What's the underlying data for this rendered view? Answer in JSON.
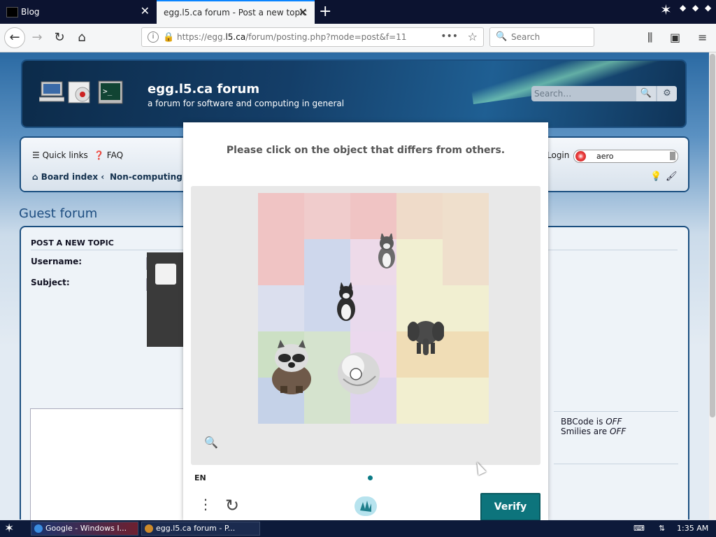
{
  "browser": {
    "tabs": [
      {
        "title": "Blog",
        "active": false
      },
      {
        "title": "egg.l5.ca forum - Post a new topic",
        "active": true
      }
    ],
    "url_prefix": "https://egg.",
    "url_domain": "l5.ca",
    "url_path": "/forum/posting.php?mode=post&f=11",
    "search_placeholder": "Search"
  },
  "header": {
    "site_title": "egg.l5.ca forum",
    "site_description": "a forum for software and computing in general",
    "search_placeholder": "Search…"
  },
  "nav": {
    "quick_links": "Quick links",
    "faq": "FAQ",
    "board_index": "Board index",
    "separator": "‹",
    "breadcrumb_forum": "Non-computing",
    "login": "Login",
    "style_select": "aero"
  },
  "forum": {
    "title": "Guest forum",
    "section": "POST A NEW TOPIC",
    "username_label": "Username:",
    "subject_label": "Subject:",
    "bbcode_prefix": "BBCode is",
    "bbcode_value": "OFF",
    "smilies_prefix": "Smilies are",
    "smilies_value": "OFF"
  },
  "captcha": {
    "prompt": "Please click on the object that differs from others.",
    "language": "EN",
    "verify_label": "Verify",
    "objects": [
      "cat",
      "cat",
      "elephant",
      "raccoon",
      "ball"
    ]
  },
  "taskbar": {
    "items": [
      {
        "title": "Google - Windows I..."
      },
      {
        "title": "egg.l5.ca forum - P..."
      }
    ],
    "time": "1:35 AM"
  },
  "colors": {
    "verify_button": "#0d747c",
    "header_bg": "#143e68",
    "forum_title": "#1d4d80"
  }
}
